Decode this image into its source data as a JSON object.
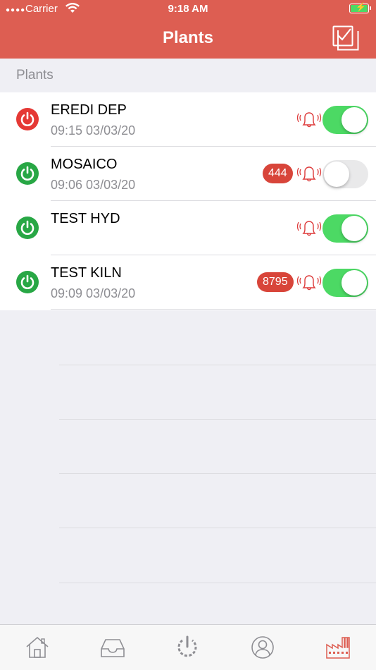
{
  "status_bar": {
    "carrier": "Carrier",
    "time": "9:18 AM"
  },
  "header": {
    "title": "Plants"
  },
  "section": {
    "title": "Plants"
  },
  "plants": [
    {
      "name": "EREDI DEP",
      "timestamp": "09:15 03/03/20",
      "status": "off",
      "badge": "",
      "alarm_enabled": true
    },
    {
      "name": "MOSAICO",
      "timestamp": "09:06 03/03/20",
      "status": "on",
      "badge": "444",
      "alarm_enabled": false
    },
    {
      "name": "TEST HYD",
      "timestamp": "",
      "status": "on",
      "badge": "",
      "alarm_enabled": true
    },
    {
      "name": "TEST KILN",
      "timestamp": "09:09 03/03/20",
      "status": "on",
      "badge": "8795",
      "alarm_enabled": true
    }
  ],
  "tabs": [
    {
      "icon": "home-icon"
    },
    {
      "icon": "inbox-icon"
    },
    {
      "icon": "power-loading-icon"
    },
    {
      "icon": "user-icon"
    },
    {
      "icon": "factory-icon",
      "selected": true
    }
  ],
  "colors": {
    "accent": "#dd5e52",
    "power_on": "#28a745",
    "power_off": "#e53935",
    "toggle_on": "#4cd964",
    "badge": "#d8453a",
    "tab_inactive": "#8e8e93"
  }
}
